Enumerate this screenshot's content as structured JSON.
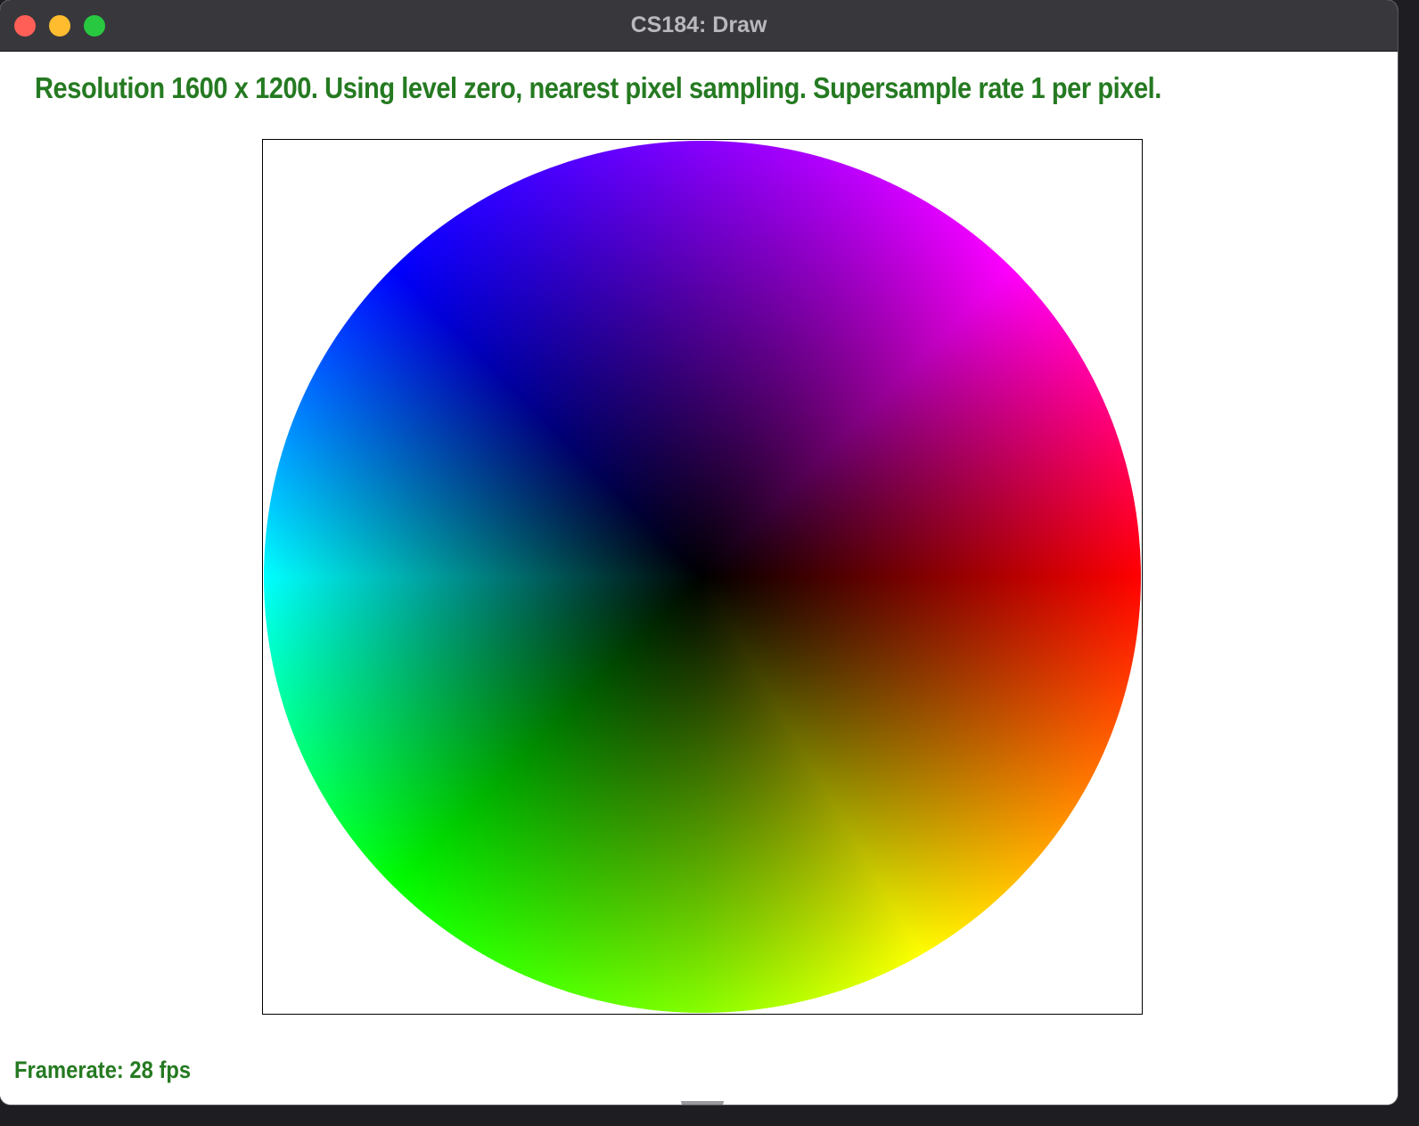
{
  "window": {
    "title": "CS184: Draw",
    "controls": {
      "close_color": "#ff5f57",
      "minimize_color": "#febc2e",
      "zoom_color": "#28c840"
    }
  },
  "status": {
    "text": "Resolution 1600 x 1200. Using level zero, nearest pixel sampling. Supersample rate 1 per pixel.",
    "framerate": "Framerate: 28 fps",
    "text_color": "#257a21"
  },
  "canvas": {
    "shape": "circle",
    "fill": "hue color wheel, black at center",
    "colors": {
      "right": "#ff0000",
      "top": "#8800ff",
      "top_right": "#ff00ff",
      "top_left": "#0000ff",
      "left": "#00ffff",
      "bottom_left": "#00ff00",
      "bottom": "#88ff00",
      "bottom_right": "#ffff00",
      "center": "#000000"
    }
  }
}
